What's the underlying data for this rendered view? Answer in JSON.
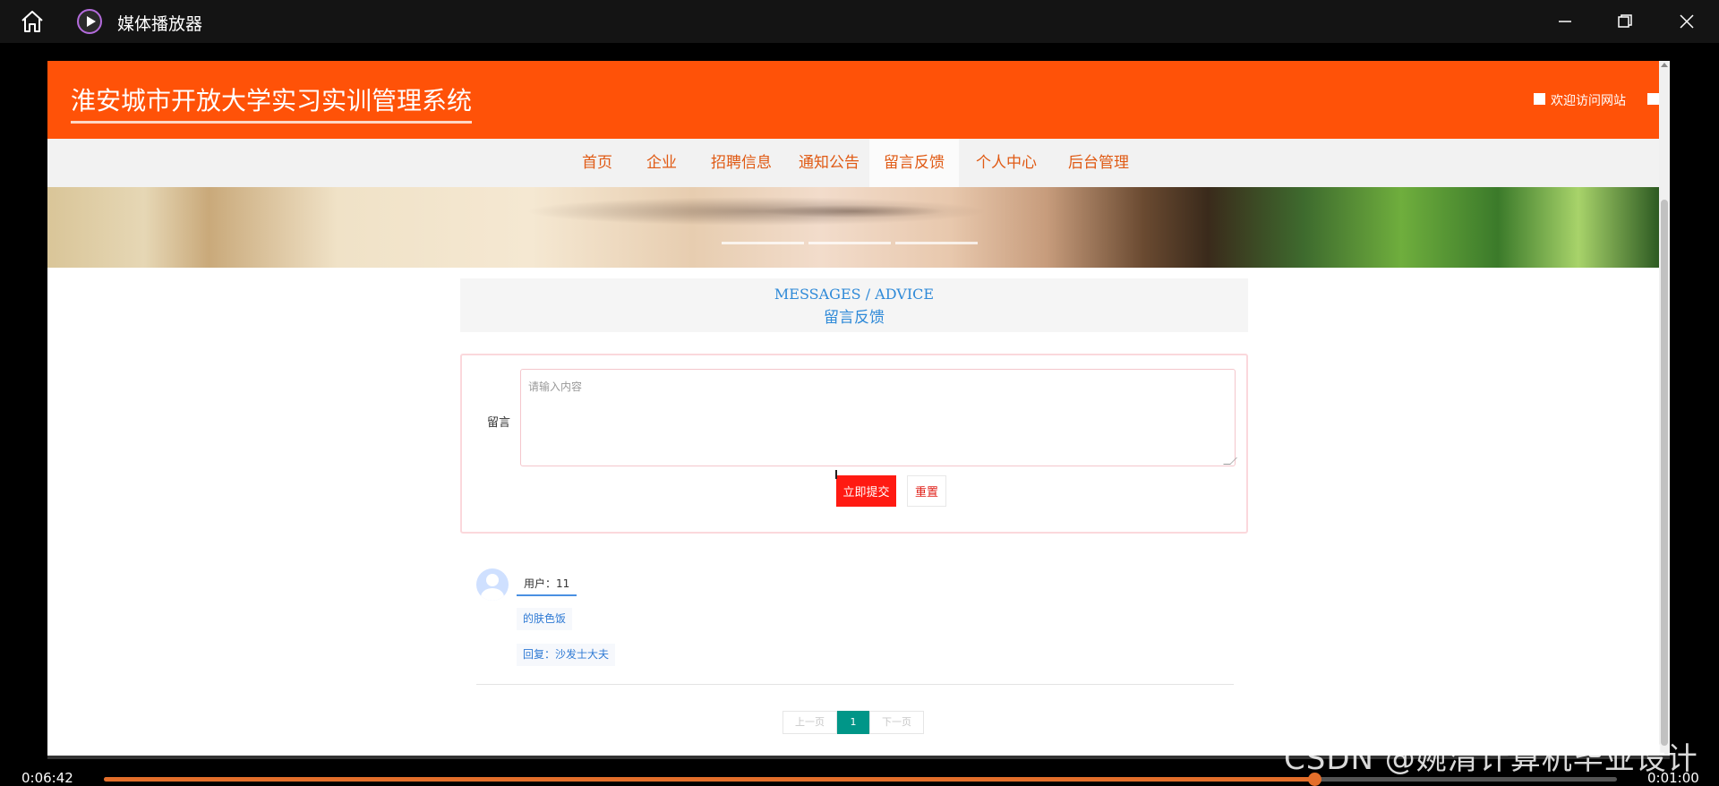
{
  "window": {
    "title": "媒体播放器",
    "icons": {
      "home": "home-icon",
      "app": "play-icon",
      "minimize": "minimize-icon",
      "maximize": "maximize-icon",
      "close": "close-icon"
    }
  },
  "site": {
    "title": "淮安城市开放大学实习实训管理系统",
    "welcome": "欢迎访问网站",
    "colors": {
      "header": "#ff5208",
      "nav_text": "#e05a14",
      "accent_blue": "#2f8ad8",
      "submit": "#ff1a12",
      "pager_active": "#009688"
    }
  },
  "nav": {
    "items": [
      {
        "label": "首页"
      },
      {
        "label": "企业"
      },
      {
        "label": "招聘信息"
      },
      {
        "label": "通知公告"
      },
      {
        "label": "留言反馈",
        "active": true
      },
      {
        "label": "个人中心"
      },
      {
        "label": "后台管理"
      }
    ]
  },
  "section": {
    "title_en": "MESSAGES / ADVICE",
    "title_cn": "留言反馈"
  },
  "form": {
    "label": "留言",
    "placeholder": "请输入内容",
    "value": "",
    "submit_label": "立即提交",
    "reset_label": "重置"
  },
  "messages": [
    {
      "user": "用户：11",
      "content": "的肤色饭",
      "reply": "回复：沙发士大夫"
    }
  ],
  "pagination": {
    "prev": "上一页",
    "current": "1",
    "next": "下一页"
  },
  "player": {
    "current_time": "0:06:42",
    "end_time": "0:01:00",
    "progress": 0.8
  },
  "watermark": "CSDN @婉清计算机毕业设计"
}
